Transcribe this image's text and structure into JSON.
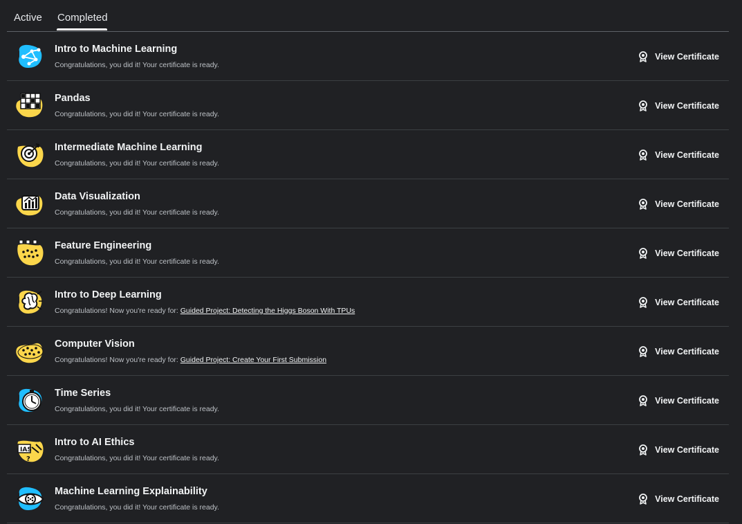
{
  "tabs": [
    {
      "label": "Active",
      "selected": false
    },
    {
      "label": "Completed",
      "selected": true
    }
  ],
  "courses": [
    {
      "title": "Intro to Machine Learning",
      "message": "Congratulations, you did it! Your certificate is ready.",
      "link": "",
      "cert_label": "View Certificate",
      "icon": "machine-learning-icon",
      "blob_color": "#20beff"
    },
    {
      "title": "Pandas",
      "message": "Congratulations, you did it! Your certificate is ready.",
      "link": "",
      "cert_label": "View Certificate",
      "icon": "pandas-grid-icon",
      "blob_color": "#fbd64b"
    },
    {
      "title": "Intermediate Machine Learning",
      "message": "Congratulations, you did it! Your certificate is ready.",
      "link": "",
      "cert_label": "View Certificate",
      "icon": "target-icon",
      "blob_color": "#fbd64b"
    },
    {
      "title": "Data Visualization",
      "message": "Congratulations, you did it! Your certificate is ready.",
      "link": "",
      "cert_label": "View Certificate",
      "icon": "chart-icon",
      "blob_color": "#fbd64b"
    },
    {
      "title": "Feature Engineering",
      "message": "Congratulations, you did it! Your certificate is ready.",
      "link": "",
      "cert_label": "View Certificate",
      "icon": "feature-engineering-icon",
      "blob_color": "#fbd64b"
    },
    {
      "title": "Intro to Deep Learning",
      "message": "Congratulations! Now you're ready for: ",
      "link": "Guided Project: Detecting the Higgs Boson With TPUs",
      "cert_label": "View Certificate",
      "icon": "brain-network-icon",
      "blob_color": "#fbd64b"
    },
    {
      "title": "Computer Vision",
      "message": "Congratulations! Now you're ready for: ",
      "link": "Guided Project: Create Your First Submission",
      "cert_label": "View Certificate",
      "icon": "computer-vision-icon",
      "blob_color": "#fbd64b"
    },
    {
      "title": "Time Series",
      "message": "Congratulations, you did it! Your certificate is ready.",
      "link": "",
      "cert_label": "View Certificate",
      "icon": "stopwatch-icon",
      "blob_color": "#20beff"
    },
    {
      "title": "Intro to AI Ethics",
      "message": "Congratulations, you did it! Your certificate is ready.",
      "link": "",
      "cert_label": "View Certificate",
      "icon": "ai-ethics-icon",
      "blob_color": "#fbd64b"
    },
    {
      "title": "Machine Learning Explainability",
      "message": "Congratulations, you did it! Your certificate is ready.",
      "link": "",
      "cert_label": "View Certificate",
      "icon": "eye-icon",
      "blob_color": "#20beff"
    }
  ]
}
